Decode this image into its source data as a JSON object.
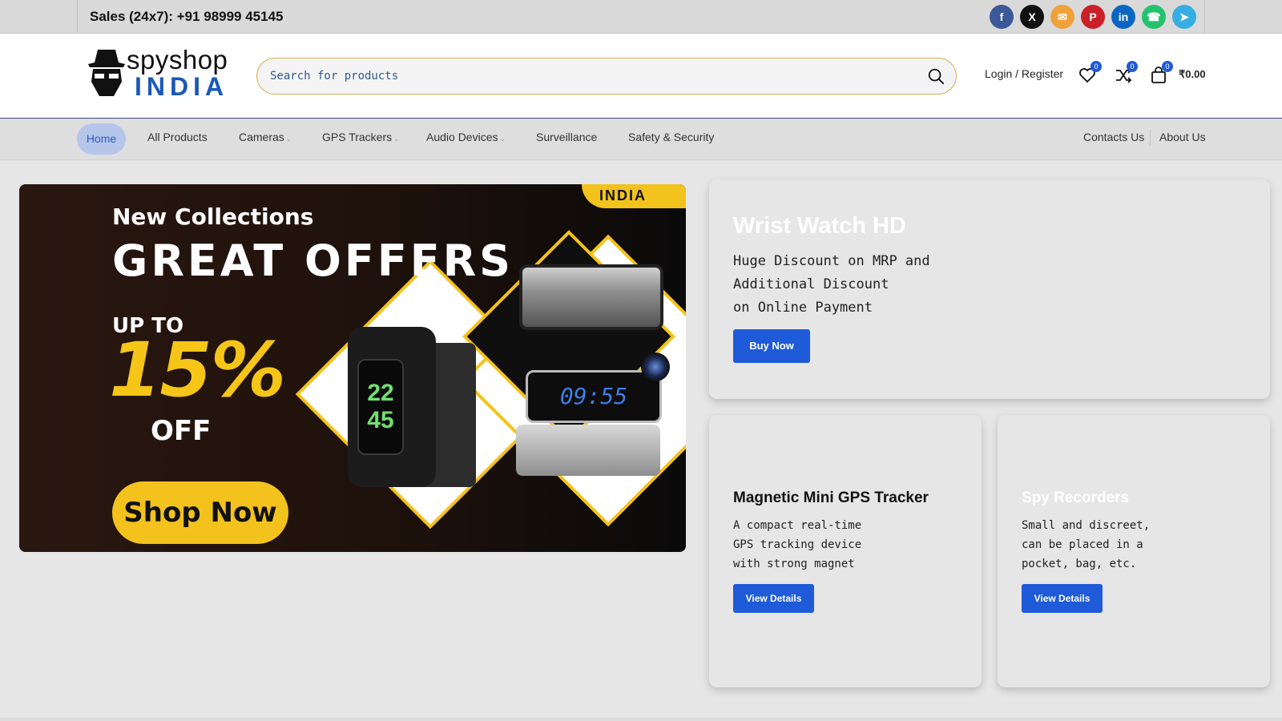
{
  "topbar": {
    "sales": "Sales (24x7): +91 98999 45145",
    "socials": [
      {
        "name": "facebook",
        "glyph": "f",
        "color": "#3b5998"
      },
      {
        "name": "x",
        "glyph": "X",
        "color": "#111111"
      },
      {
        "name": "email",
        "glyph": "✉",
        "color": "#f0a13a"
      },
      {
        "name": "pinterest",
        "glyph": "P",
        "color": "#cb2027"
      },
      {
        "name": "linkedin",
        "glyph": "in",
        "color": "#0a66c2"
      },
      {
        "name": "whatsapp",
        "glyph": "☎",
        "color": "#25c26e"
      },
      {
        "name": "telegram",
        "glyph": "➤",
        "color": "#37aee2"
      }
    ]
  },
  "header": {
    "logo_top": "spyshop",
    "logo_bottom": "INDIA",
    "search_placeholder": "Search for products",
    "login": "Login / Register",
    "wishlist_count": "0",
    "compare_count": "0",
    "cart_count": "0",
    "cart_total": "₹0.00"
  },
  "nav": {
    "home": "Home",
    "all_products": "All Products",
    "cameras": "Cameras",
    "gps": "GPS Trackers",
    "audio": "Audio Devices",
    "surveillance": "Surveillance",
    "safety": "Safety & Security",
    "contacts": "Contacts Us",
    "about": "About Us",
    "caret": "⌄"
  },
  "banner": {
    "watermark": "INDIA",
    "new_collections": "New Collections",
    "great_offers": "GREAT OFFERS",
    "up_to": "UP TO",
    "percent": "15%",
    "off": "OFF",
    "shop_now": "Shop Now",
    "watch_time_h": "22",
    "watch_time_m": "45",
    "clock_time": "09:55"
  },
  "cards": {
    "watch": {
      "title": "Wrist Watch HD",
      "desc": [
        "Huge Discount on MRP and",
        "Additional Discount",
        "on Online Payment"
      ],
      "button": "Buy Now"
    },
    "gps": {
      "title": "Magnetic Mini GPS Tracker",
      "desc": [
        "A compact real-time",
        "GPS tracking device",
        "with strong magnet"
      ],
      "button": "View Details"
    },
    "recorders": {
      "title": "Spy Recorders",
      "desc": [
        "Small and discreet,",
        "can be placed in a",
        "pocket, bag, etc."
      ],
      "button": "View Details"
    }
  }
}
